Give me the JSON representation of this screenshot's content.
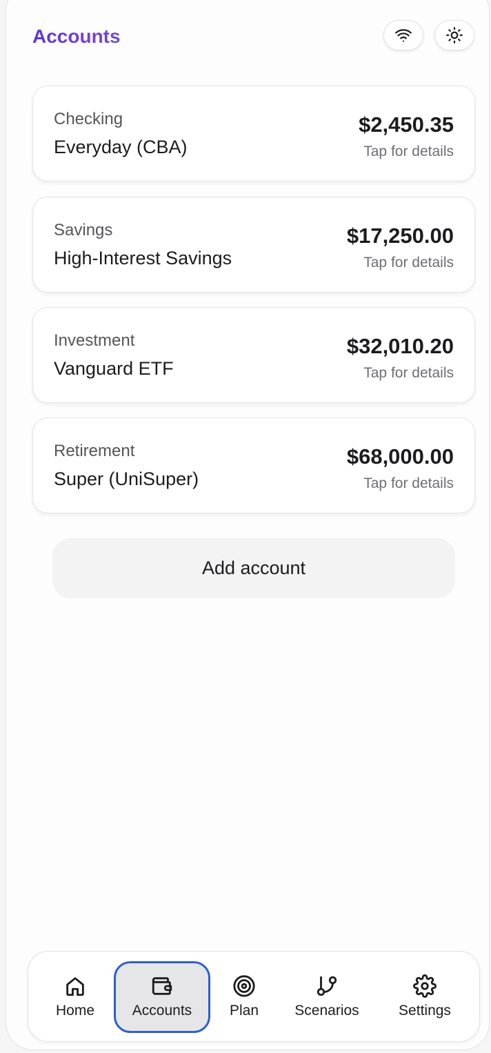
{
  "header": {
    "title": "Accounts",
    "wifi_icon": "wifi-icon",
    "theme_icon": "sun-icon"
  },
  "accounts": [
    {
      "type": "Checking",
      "name": "Everyday (CBA)",
      "amount": "$2,450.35",
      "hint": "Tap for details"
    },
    {
      "type": "Savings",
      "name": "High-Interest Savings",
      "amount": "$17,250.00",
      "hint": "Tap for details"
    },
    {
      "type": "Investment",
      "name": "Vanguard ETF",
      "amount": "$32,010.20",
      "hint": "Tap for details"
    },
    {
      "type": "Retirement",
      "name": "Super (UniSuper)",
      "amount": "$68,000.00",
      "hint": "Tap for details"
    }
  ],
  "add_account_label": "Add account",
  "tabbar": {
    "active": "Accounts",
    "active_outline_color": "#2f5fc9",
    "tabs": [
      {
        "label": "Home",
        "icon": "home-icon"
      },
      {
        "label": "Accounts",
        "icon": "wallet-icon"
      },
      {
        "label": "Plan",
        "icon": "target-icon"
      },
      {
        "label": "Scenarios",
        "icon": "git-branch-icon"
      },
      {
        "label": "Settings",
        "icon": "gear-icon"
      }
    ]
  },
  "colors": {
    "title_gradient_start": "#5b35d6",
    "title_gradient_end": "#6a4fc8"
  }
}
